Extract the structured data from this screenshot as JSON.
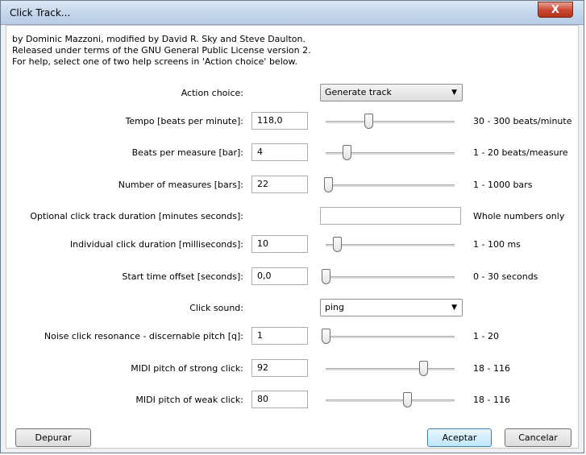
{
  "window": {
    "title": "Click Track...",
    "close_label": "X"
  },
  "info": [
    "by Dominic Mazzoni, modified by David R. Sky and Steve Daulton.",
    "Released under terms of the GNU General Public License version 2.",
    "For help, select one of two help screens in 'Action choice' below."
  ],
  "action": {
    "label": "Action choice:",
    "value": "Generate track"
  },
  "tempo": {
    "label": "Tempo [beats per minute]:",
    "value": "118,0",
    "range": "30 - 300 beats/minute",
    "level": 0.33
  },
  "beats": {
    "label": "Beats per measure [bar]:",
    "value": "4",
    "range": "1 - 20 beats/measure",
    "level": 0.16
  },
  "measures": {
    "label": "Number of measures [bars]:",
    "value": "22",
    "range": "1 - 1000 bars",
    "level": 0.02
  },
  "duration": {
    "label": "Optional click track duration [minutes seconds]:",
    "value": "",
    "range": "Whole numbers only"
  },
  "click_duration": {
    "label": "Individual click duration [milliseconds]:",
    "value": "10",
    "range": "1 - 100 ms",
    "level": 0.09
  },
  "offset": {
    "label": "Start time offset [seconds]:",
    "value": "0,0",
    "range": "0 - 30 seconds",
    "level": 0.0
  },
  "sound": {
    "label": "Click sound:",
    "value": "ping"
  },
  "resonance": {
    "label": "Noise click resonance - discernable pitch [q]:",
    "value": "1",
    "range": "1 - 20",
    "level": 0.0
  },
  "strong": {
    "label": "MIDI pitch of strong click:",
    "value": "92",
    "range": "18 - 116",
    "level": 0.755
  },
  "weak": {
    "label": "MIDI pitch of weak click:",
    "value": "80",
    "range": "18 - 116",
    "level": 0.633
  },
  "buttons": {
    "debug": "Depurar",
    "ok": "Aceptar",
    "cancel": "Cancelar"
  }
}
